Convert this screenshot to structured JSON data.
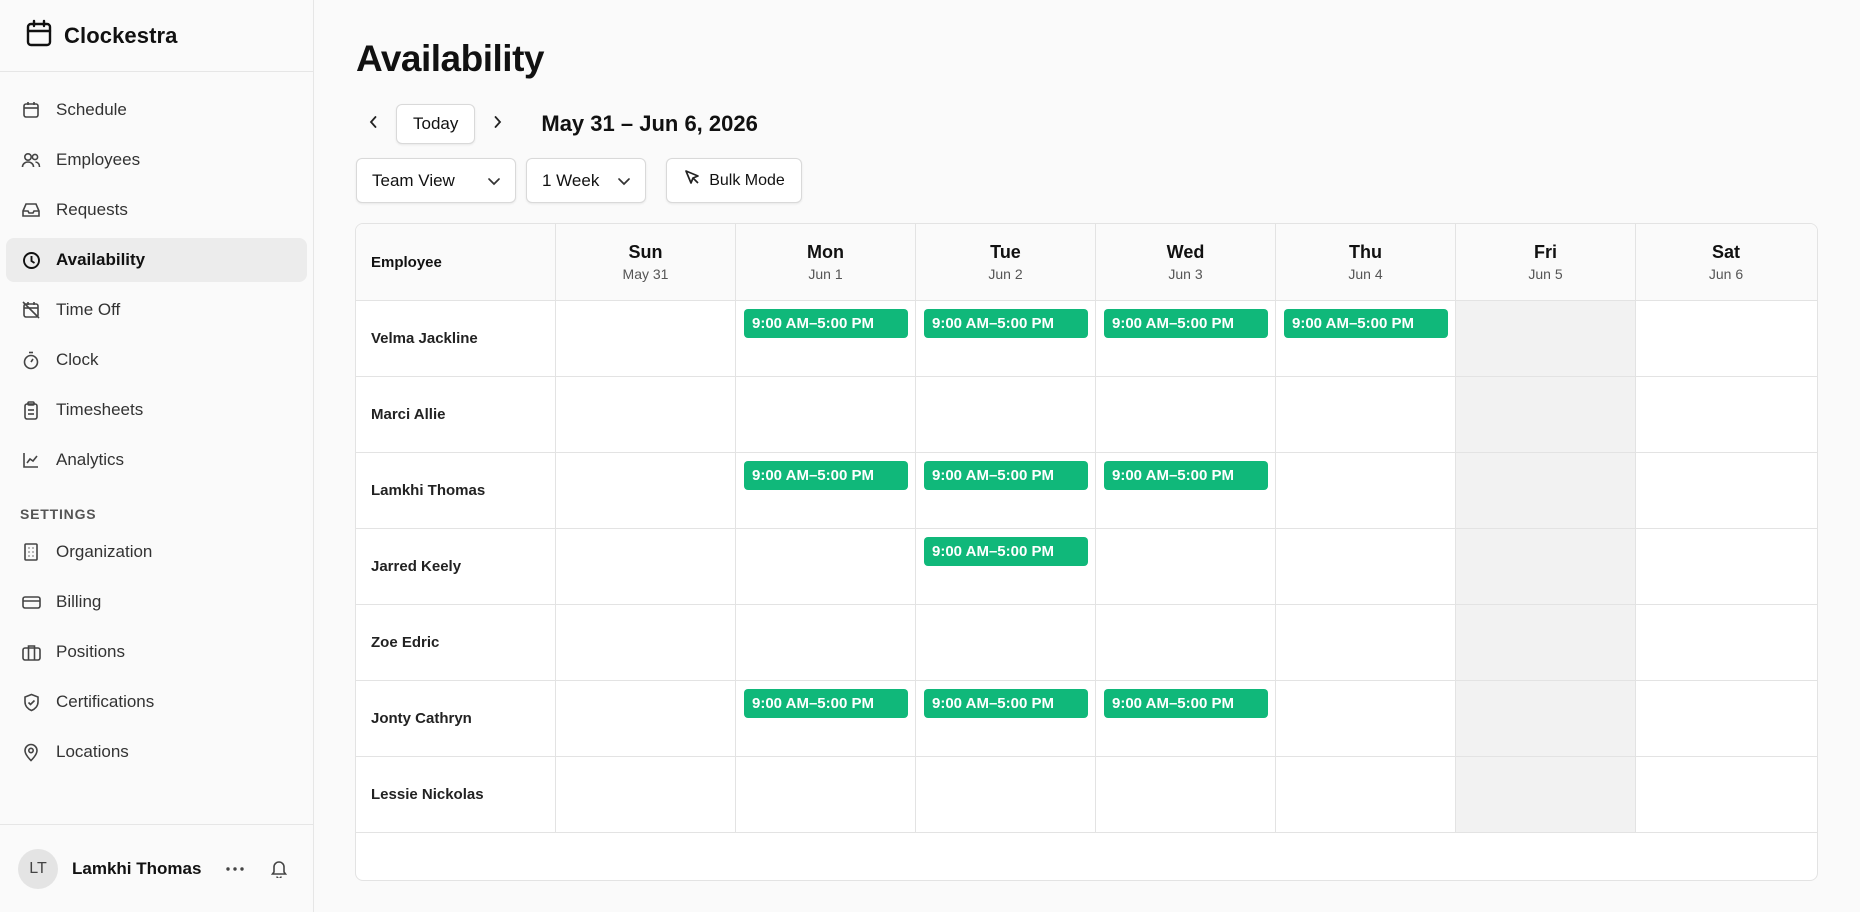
{
  "app": {
    "name": "Clockestra"
  },
  "sidebar": {
    "items": [
      {
        "label": "Schedule",
        "icon": "calendar-icon"
      },
      {
        "label": "Employees",
        "icon": "users-icon"
      },
      {
        "label": "Requests",
        "icon": "inbox-icon"
      },
      {
        "label": "Availability",
        "icon": "clock-icon",
        "active": true
      },
      {
        "label": "Time Off",
        "icon": "calendar-off-icon"
      },
      {
        "label": "Clock",
        "icon": "timer-icon"
      },
      {
        "label": "Timesheets",
        "icon": "clipboard-icon"
      },
      {
        "label": "Analytics",
        "icon": "chart-line-icon"
      }
    ],
    "settings_label": "SETTINGS",
    "settings_items": [
      {
        "label": "Organization",
        "icon": "building-icon"
      },
      {
        "label": "Billing",
        "icon": "credit-card-icon"
      },
      {
        "label": "Positions",
        "icon": "briefcase-icon"
      },
      {
        "label": "Certifications",
        "icon": "shield-check-icon"
      },
      {
        "label": "Locations",
        "icon": "map-pin-icon"
      }
    ]
  },
  "user": {
    "initials": "LT",
    "name": "Lamkhi Thomas"
  },
  "page": {
    "title": "Availability",
    "today_label": "Today",
    "range_label": "May 31 – Jun 6, 2026",
    "view_select": "Team View",
    "period_select": "1 Week",
    "bulk_label": "Bulk Mode"
  },
  "grid": {
    "employee_header": "Employee",
    "days": [
      {
        "name": "Sun",
        "date": "May 31"
      },
      {
        "name": "Mon",
        "date": "Jun 1"
      },
      {
        "name": "Tue",
        "date": "Jun 2"
      },
      {
        "name": "Wed",
        "date": "Jun 3"
      },
      {
        "name": "Thu",
        "date": "Jun 4"
      },
      {
        "name": "Fri",
        "date": "Jun 5",
        "unavailable": true
      },
      {
        "name": "Sat",
        "date": "Jun 6"
      }
    ],
    "rows": [
      {
        "name": "Velma Jackline",
        "slots": [
          "",
          "9:00 AM–5:00 PM",
          "9:00 AM–5:00 PM",
          "9:00 AM–5:00 PM",
          "9:00 AM–5:00 PM",
          "",
          ""
        ]
      },
      {
        "name": "Marci Allie",
        "slots": [
          "",
          "",
          "",
          "",
          "",
          "",
          ""
        ]
      },
      {
        "name": "Lamkhi Thomas",
        "slots": [
          "",
          "9:00 AM–5:00 PM",
          "9:00 AM–5:00 PM",
          "9:00 AM–5:00 PM",
          "",
          "",
          ""
        ]
      },
      {
        "name": "Jarred Keely",
        "slots": [
          "",
          "",
          "9:00 AM–5:00 PM",
          "",
          "",
          "",
          ""
        ]
      },
      {
        "name": "Zoe Edric",
        "slots": [
          "",
          "",
          "",
          "",
          "",
          "",
          ""
        ]
      },
      {
        "name": "Jonty Cathryn",
        "slots": [
          "",
          "9:00 AM–5:00 PM",
          "9:00 AM–5:00 PM",
          "9:00 AM–5:00 PM",
          "",
          "",
          ""
        ]
      },
      {
        "name": "Lessie Nickolas",
        "slots": [
          "",
          "",
          "",
          "",
          "",
          "",
          ""
        ]
      }
    ]
  },
  "colors": {
    "available": "#10b87a",
    "unavailable_bg": "#f2f2f2",
    "active_nav_bg": "#ececec"
  }
}
